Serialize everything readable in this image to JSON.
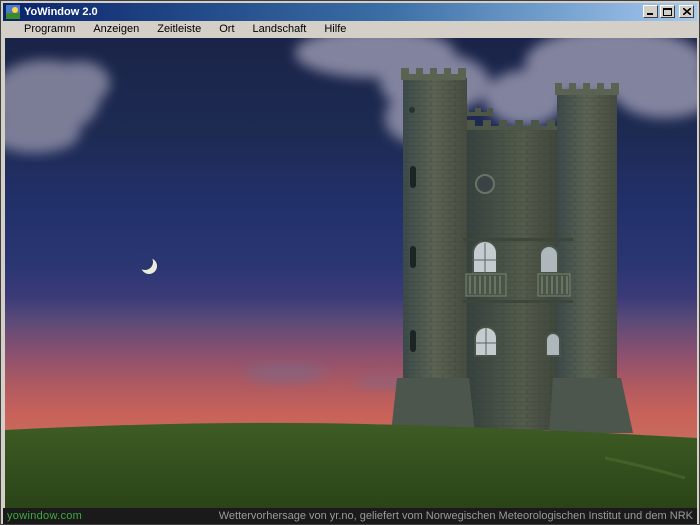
{
  "window": {
    "title": "YoWindow 2.0"
  },
  "menu": {
    "items": [
      {
        "label": "Programm"
      },
      {
        "label": "Anzeigen"
      },
      {
        "label": "Zeitleiste"
      },
      {
        "label": "Ort"
      },
      {
        "label": "Landschaft"
      },
      {
        "label": "Hilfe"
      }
    ]
  },
  "status": {
    "brand": "yowindow.com",
    "credit": "Wettervorhersage von yr.no, geliefert vom Norwegischen Meteorologischen Institut und dem NRK"
  },
  "scene": {
    "icons": [
      "moon-icon",
      "cloud-icon",
      "tower-icon",
      "hill-icon"
    ],
    "colors": {
      "sky_top": "#1a2448",
      "horizon": "#c8625a",
      "grass": "#3c5a22",
      "stone": "#5a6052"
    }
  }
}
